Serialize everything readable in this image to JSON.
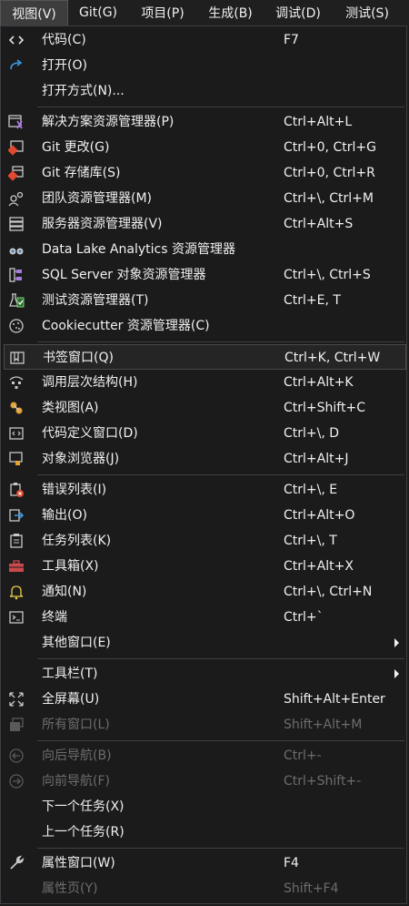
{
  "menubar": [
    {
      "label": "视图(V)",
      "active": true
    },
    {
      "label": "Git(G)"
    },
    {
      "label": "项目(P)"
    },
    {
      "label": "生成(B)"
    },
    {
      "label": "调试(D)"
    },
    {
      "label": "测试(S)"
    }
  ],
  "items": [
    {
      "label": "代码(C)",
      "shortcut": "F7",
      "icon": "code-icon"
    },
    {
      "label": "打开(O)",
      "shortcut": "",
      "icon": "open-arrow-icon"
    },
    {
      "label": "打开方式(N)...",
      "shortcut": "",
      "icon": ""
    },
    {
      "label": "解决方案资源管理器(P)",
      "shortcut": "Ctrl+Alt+L",
      "icon": "solution-explorer-icon"
    },
    {
      "label": "Git 更改(G)",
      "shortcut": "Ctrl+0, Ctrl+G",
      "icon": "git-changes-icon"
    },
    {
      "label": "Git 存储库(S)",
      "shortcut": "Ctrl+0, Ctrl+R",
      "icon": "git-repository-icon"
    },
    {
      "label": "团队资源管理器(M)",
      "shortcut": "Ctrl+\\, Ctrl+M",
      "icon": "team-explorer-icon"
    },
    {
      "label": "服务器资源管理器(V)",
      "shortcut": "Ctrl+Alt+S",
      "icon": "server-explorer-icon"
    },
    {
      "label": "Data Lake Analytics 资源管理器",
      "shortcut": "",
      "icon": "binoculars-icon"
    },
    {
      "label": "SQL Server 对象资源管理器",
      "shortcut": "Ctrl+\\, Ctrl+S",
      "icon": "sql-server-icon"
    },
    {
      "label": "测试资源管理器(T)",
      "shortcut": "Ctrl+E, T",
      "icon": "test-explorer-icon"
    },
    {
      "label": "Cookiecutter 资源管理器(C)",
      "shortcut": "",
      "icon": "cookie-icon"
    },
    {
      "label": "书签窗口(Q)",
      "shortcut": "Ctrl+K, Ctrl+W",
      "icon": "bookmark-icon"
    },
    {
      "label": "调用层次结构(H)",
      "shortcut": "Ctrl+Alt+K",
      "icon": "call-hierarchy-icon"
    },
    {
      "label": "类视图(A)",
      "shortcut": "Ctrl+Shift+C",
      "icon": "class-view-icon"
    },
    {
      "label": "代码定义窗口(D)",
      "shortcut": "Ctrl+\\, D",
      "icon": "code-definition-icon"
    },
    {
      "label": "对象浏览器(J)",
      "shortcut": "Ctrl+Alt+J",
      "icon": "object-browser-icon"
    },
    {
      "label": "错误列表(I)",
      "shortcut": "Ctrl+\\, E",
      "icon": "error-list-icon"
    },
    {
      "label": "输出(O)",
      "shortcut": "Ctrl+Alt+O",
      "icon": "output-icon"
    },
    {
      "label": "任务列表(K)",
      "shortcut": "Ctrl+\\, T",
      "icon": "task-list-icon"
    },
    {
      "label": "工具箱(X)",
      "shortcut": "Ctrl+Alt+X",
      "icon": "toolbox-icon"
    },
    {
      "label": "通知(N)",
      "shortcut": "Ctrl+\\, Ctrl+N",
      "icon": "bell-icon"
    },
    {
      "label": "终端",
      "shortcut": "Ctrl+`",
      "icon": "terminal-icon"
    },
    {
      "label": "其他窗口(E)",
      "shortcut": "",
      "icon": ""
    },
    {
      "label": "工具栏(T)",
      "shortcut": "",
      "icon": ""
    },
    {
      "label": "全屏幕(U)",
      "shortcut": "Shift+Alt+Enter",
      "icon": "fullscreen-icon"
    },
    {
      "label": "所有窗口(L)",
      "shortcut": "Shift+Alt+M",
      "icon": "all-windows-icon"
    },
    {
      "label": "向后导航(B)",
      "shortcut": "Ctrl+-",
      "icon": "navigate-back-icon"
    },
    {
      "label": "向前导航(F)",
      "shortcut": "Ctrl+Shift+-",
      "icon": "navigate-forward-icon"
    },
    {
      "label": "下一个任务(X)",
      "shortcut": "",
      "icon": ""
    },
    {
      "label": "上一个任务(R)",
      "shortcut": "",
      "icon": ""
    },
    {
      "label": "属性窗口(W)",
      "shortcut": "F4",
      "icon": "wrench-icon"
    },
    {
      "label": "属性页(Y)",
      "shortcut": "Shift+F4",
      "icon": ""
    }
  ]
}
